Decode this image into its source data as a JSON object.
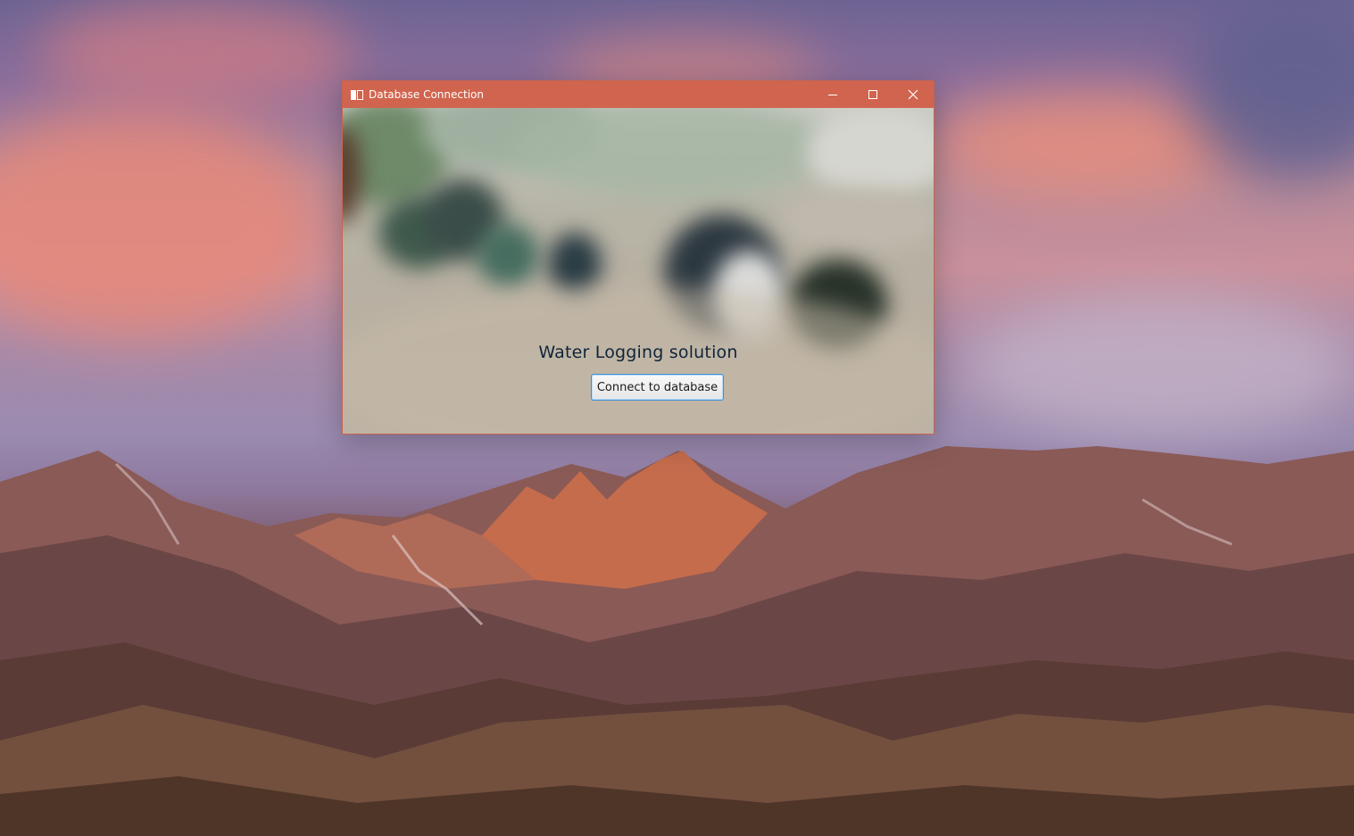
{
  "window": {
    "title": "Database Connection",
    "accent_color": "#d1644e",
    "controls": {
      "minimize_icon": "minimize-icon",
      "maximize_icon": "maximize-icon",
      "close_icon": "close-icon"
    }
  },
  "main": {
    "heading": "Water Logging solution",
    "connect_button_label": "Connect to database"
  }
}
